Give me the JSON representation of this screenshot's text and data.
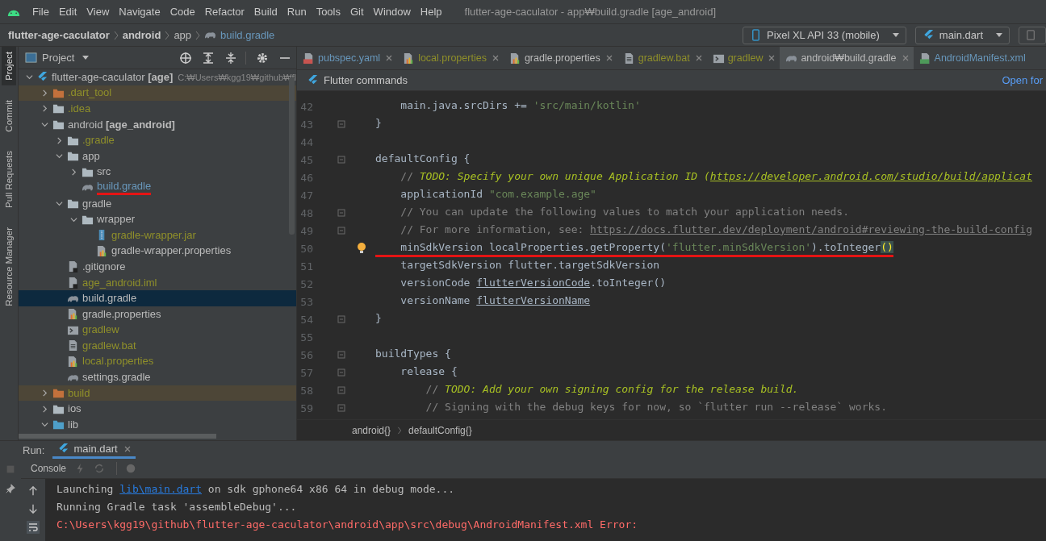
{
  "menu_bar": {
    "items": [
      "File",
      "Edit",
      "View",
      "Navigate",
      "Code",
      "Refactor",
      "Build",
      "Run",
      "Tools",
      "Git",
      "Window",
      "Help"
    ],
    "title": "flutter-age-caculator - app₩build.gradle [age_android]"
  },
  "nav_bar": {
    "breadcrumb": [
      {
        "label": "flutter-age-caculator",
        "kind": "bold"
      },
      {
        "label": "android",
        "kind": "bold"
      },
      {
        "label": "app",
        "kind": "plain"
      },
      {
        "label": "build.gradle",
        "kind": "file"
      }
    ],
    "device": "Pixel XL API 33 (mobile)",
    "run_config": "main.dart"
  },
  "tool_stripe": [
    {
      "label": "Project",
      "selected": true
    },
    {
      "label": "Commit",
      "selected": false
    },
    {
      "label": "Pull Requests",
      "selected": false
    },
    {
      "label": "Resource Manager",
      "selected": false
    }
  ],
  "project_panel": {
    "title": "Project",
    "tree": [
      {
        "label": "flutter-age-caculator **[age]**",
        "path": "C:₩Users₩kgg19₩github₩fl",
        "kind": "flutter",
        "ignored": false,
        "modified": false,
        "expanded": true,
        "excluded": false,
        "selected": false,
        "annotated": false,
        "children": [
          {
            "label": ".dart_tool",
            "kind": "folder_excluded",
            "ignored": true,
            "modified": false,
            "expanded": false,
            "excluded": true,
            "selected": false,
            "annotated": false
          },
          {
            "label": ".idea",
            "kind": "folder_idea",
            "ignored": true,
            "modified": false,
            "expanded": false,
            "excluded": false,
            "selected": false,
            "annotated": false
          },
          {
            "label": "android **[age_android]**",
            "kind": "folder_module",
            "ignored": false,
            "modified": false,
            "expanded": true,
            "excluded": false,
            "selected": false,
            "annotated": false,
            "children": [
              {
                "label": ".gradle",
                "kind": "folder",
                "ignored": true,
                "modified": false,
                "expanded": false,
                "excluded": false,
                "selected": false,
                "annotated": false
              },
              {
                "label": "app",
                "kind": "folder",
                "ignored": false,
                "modified": false,
                "expanded": true,
                "excluded": false,
                "selected": false,
                "annotated": false,
                "children": [
                  {
                    "label": "src",
                    "kind": "folder",
                    "ignored": false,
                    "modified": false,
                    "expanded": false,
                    "excluded": false,
                    "selected": false,
                    "annotated": false
                  },
                  {
                    "label": "build.gradle",
                    "kind": "gradle",
                    "ignored": false,
                    "modified": true,
                    "excluded": false,
                    "selected": false,
                    "annotated": true
                  }
                ]
              },
              {
                "label": "gradle",
                "kind": "folder",
                "ignored": false,
                "modified": false,
                "expanded": true,
                "excluded": false,
                "selected": false,
                "annotated": false,
                "children": [
                  {
                    "label": "wrapper",
                    "kind": "folder",
                    "ignored": false,
                    "modified": false,
                    "expanded": true,
                    "excluded": false,
                    "selected": false,
                    "annotated": false,
                    "children": [
                      {
                        "label": "gradle-wrapper.jar",
                        "kind": "jar",
                        "ignored": true,
                        "modified": false,
                        "excluded": false,
                        "selected": false,
                        "annotated": false
                      },
                      {
                        "label": "gradle-wrapper.properties",
                        "kind": "properties",
                        "ignored": false,
                        "modified": false,
                        "excluded": false,
                        "selected": false,
                        "annotated": false
                      }
                    ]
                  }
                ]
              },
              {
                "label": ".gitignore",
                "kind": "gitignore",
                "ignored": false,
                "modified": false,
                "excluded": false,
                "selected": false,
                "annotated": false
              },
              {
                "label": "age_android.iml",
                "kind": "iml",
                "ignored": true,
                "modified": false,
                "excluded": false,
                "selected": false,
                "annotated": false
              },
              {
                "label": "build.gradle",
                "kind": "gradle",
                "ignored": false,
                "modified": false,
                "excluded": false,
                "selected": true,
                "annotated": false
              },
              {
                "label": "gradle.properties",
                "kind": "properties",
                "ignored": false,
                "modified": false,
                "excluded": false,
                "selected": false,
                "annotated": false
              },
              {
                "label": "gradlew",
                "kind": "script",
                "ignored": true,
                "modified": false,
                "excluded": false,
                "selected": false,
                "annotated": false
              },
              {
                "label": "gradlew.bat",
                "kind": "text",
                "ignored": true,
                "modified": false,
                "excluded": false,
                "selected": false,
                "annotated": false
              },
              {
                "label": "local.properties",
                "kind": "properties",
                "ignored": true,
                "modified": false,
                "excluded": false,
                "selected": false,
                "annotated": false
              },
              {
                "label": "settings.gradle",
                "kind": "gradle",
                "ignored": false,
                "modified": false,
                "excluded": false,
                "selected": false,
                "annotated": false
              }
            ]
          },
          {
            "label": "build",
            "kind": "folder_excluded",
            "ignored": true,
            "modified": false,
            "expanded": false,
            "excluded": true,
            "selected": false,
            "annotated": false
          },
          {
            "label": "ios",
            "kind": "folder_module",
            "ignored": false,
            "modified": false,
            "expanded": false,
            "excluded": false,
            "selected": false,
            "annotated": false
          },
          {
            "label": "lib",
            "kind": "folder_blue",
            "ignored": false,
            "modified": false,
            "expanded": true,
            "excluded": false,
            "selected": false,
            "annotated": false
          }
        ]
      }
    ]
  },
  "editor": {
    "tabs": [
      {
        "label": "pubspec.yaml",
        "kind": "yaml",
        "ignored": false,
        "modified": true,
        "selected": false,
        "closable": true
      },
      {
        "label": "local.properties",
        "kind": "properties",
        "ignored": true,
        "modified": false,
        "selected": false,
        "closable": true
      },
      {
        "label": "gradle.properties",
        "kind": "properties",
        "ignored": false,
        "modified": false,
        "selected": false,
        "closable": true
      },
      {
        "label": "gradlew.bat",
        "kind": "text",
        "ignored": true,
        "modified": false,
        "selected": false,
        "closable": true
      },
      {
        "label": "gradlew",
        "kind": "script",
        "ignored": true,
        "modified": false,
        "selected": false,
        "closable": true
      },
      {
        "label": "android₩build.gradle",
        "kind": "gradle",
        "ignored": false,
        "modified": false,
        "selected": true,
        "closable": true
      },
      {
        "label": "AndroidManifest.xml",
        "kind": "manifest",
        "ignored": false,
        "modified": true,
        "selected": false,
        "closable": false
      }
    ],
    "banner": {
      "title": "Flutter commands",
      "link": "Open for"
    },
    "lines": [
      {
        "number": "42",
        "fold": false,
        "hint": false,
        "annotated": false,
        "segments": [
          {
            "kind": "plain",
            "text": "    main.java.srcDirs += "
          },
          {
            "kind": "string",
            "text": "'src/main/kotlin'"
          }
        ]
      },
      {
        "number": "43",
        "fold": true,
        "hint": false,
        "annotated": false,
        "segments": [
          {
            "kind": "plain",
            "text": "}"
          }
        ]
      },
      {
        "number": "44",
        "fold": false,
        "hint": false
      },
      {
        "number": "45",
        "fold": true,
        "hint": false,
        "annotated": false,
        "segments": [
          {
            "kind": "plain",
            "text": "defaultConfig {"
          }
        ]
      },
      {
        "number": "46",
        "fold": false,
        "hint": false,
        "annotated": false,
        "segments": [
          {
            "kind": "comment",
            "text": "    // "
          },
          {
            "kind": "todo",
            "text": "TODO: Specify your own unique Application ID ("
          },
          {
            "kind": "todo_link",
            "text": "https://developer.android.com/studio/build/applicat"
          }
        ]
      },
      {
        "number": "47",
        "fold": false,
        "hint": false,
        "annotated": false,
        "segments": [
          {
            "kind": "plain",
            "text": "    applicationId "
          },
          {
            "kind": "string",
            "text": "\"com.example.age\""
          }
        ]
      },
      {
        "number": "48",
        "fold": true,
        "hint": false,
        "annotated": false,
        "segments": [
          {
            "kind": "comment",
            "text": "    // You can update the following values to match your application needs."
          }
        ]
      },
      {
        "number": "49",
        "fold": true,
        "hint": false,
        "annotated": false,
        "segments": [
          {
            "kind": "comment",
            "text": "    // For more information, see: "
          },
          {
            "kind": "comment_link",
            "text": "https://docs.flutter.dev/deployment/android#reviewing-the-build-config"
          }
        ]
      },
      {
        "number": "50",
        "fold": false,
        "hint": true,
        "annotated": true,
        "segments": [
          {
            "kind": "plain",
            "text": "    minSdkVersion localProperties.getProperty("
          },
          {
            "kind": "string",
            "text": "'flutter.minSdkVersion'"
          },
          {
            "kind": "plain",
            "text": ").toInteger"
          },
          {
            "kind": "brace",
            "text": "()"
          }
        ]
      },
      {
        "number": "51",
        "fold": false,
        "hint": false,
        "annotated": false,
        "segments": [
          {
            "kind": "plain",
            "text": "    targetSdkVersion flutter.targetSdkVersion"
          }
        ]
      },
      {
        "number": "52",
        "fold": false,
        "hint": false,
        "annotated": false,
        "segments": [
          {
            "kind": "plain",
            "text": "    versionCode "
          },
          {
            "kind": "ref",
            "text": "flutterVersionCode"
          },
          {
            "kind": "plain",
            "text": ".toInteger()"
          }
        ]
      },
      {
        "number": "53",
        "fold": false,
        "hint": false,
        "annotated": false,
        "segments": [
          {
            "kind": "plain",
            "text": "    versionName "
          },
          {
            "kind": "ref",
            "text": "flutterVersionName"
          }
        ]
      },
      {
        "number": "54",
        "fold": true,
        "hint": false,
        "annotated": false,
        "segments": [
          {
            "kind": "plain",
            "text": "}"
          }
        ]
      },
      {
        "number": "55",
        "fold": false,
        "hint": false
      },
      {
        "number": "56",
        "fold": true,
        "hint": false,
        "annotated": false,
        "segments": [
          {
            "kind": "plain",
            "text": "buildTypes {"
          }
        ]
      },
      {
        "number": "57",
        "fold": true,
        "hint": false,
        "annotated": false,
        "segments": [
          {
            "kind": "plain",
            "text": "    release {"
          }
        ]
      },
      {
        "number": "58",
        "fold": true,
        "hint": false,
        "annotated": false,
        "segments": [
          {
            "kind": "comment",
            "text": "        // "
          },
          {
            "kind": "todo",
            "text": "TODO: Add your own signing config for the release build."
          }
        ]
      },
      {
        "number": "59",
        "fold": true,
        "hint": false,
        "annotated": false,
        "segments": [
          {
            "kind": "comment",
            "text": "        // Signing with the debug keys for now, so `flutter run --release` works."
          }
        ]
      }
    ],
    "breadcrumb": [
      "android{}",
      "defaultConfig{}"
    ]
  },
  "run_panel": {
    "label": "Run:",
    "tab": "main.dart",
    "console_tab": "Console",
    "output": [
      {
        "kind": "info",
        "segments": [
          {
            "kind": "plain",
            "text": "Launching "
          },
          {
            "kind": "link",
            "text": "lib\\main.dart"
          },
          {
            "kind": "plain",
            "text": " on sdk gphone64 x86 64 in debug mode..."
          }
        ]
      },
      {
        "kind": "info",
        "segments": [
          {
            "kind": "plain",
            "text": "Running Gradle task 'assembleDebug'..."
          }
        ]
      },
      {
        "kind": "error",
        "segments": [
          {
            "kind": "plain",
            "text": "C:\\Users\\kgg19\\github\\flutter-age-caculator\\android\\app\\src\\debug\\AndroidManifest.xml Error:"
          }
        ]
      }
    ]
  }
}
